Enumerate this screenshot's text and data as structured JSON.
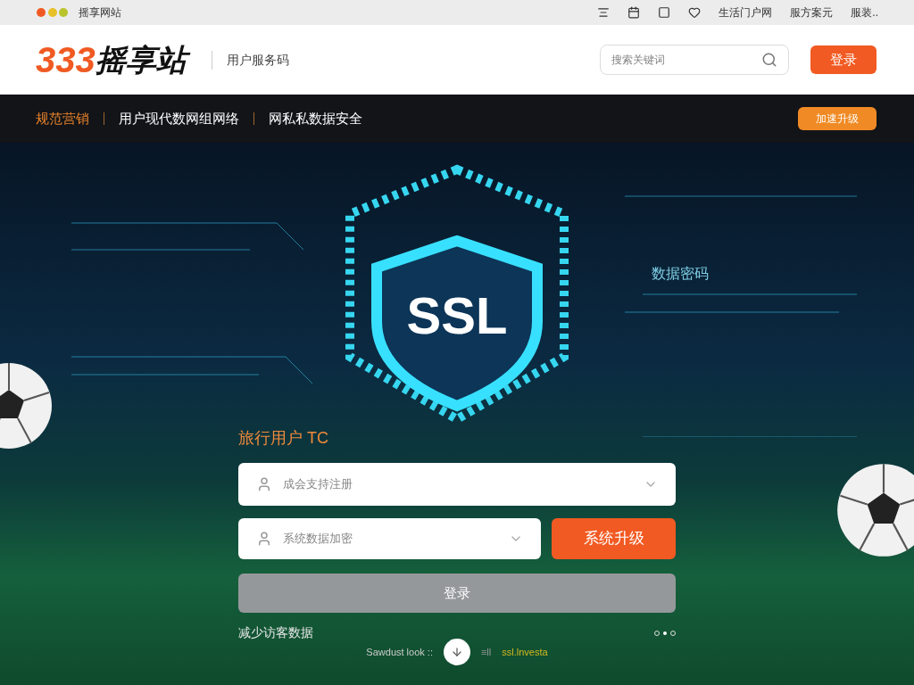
{
  "top_bar": {
    "site_name": "摇享网站",
    "links": [
      "生活门户网",
      "服方案元",
      "服装.."
    ]
  },
  "header": {
    "logo_number": "333",
    "logo_text": "摇享站",
    "tagline": "用户服务码",
    "search": {
      "placeholder": "搜索关键词"
    },
    "login_button": "登录"
  },
  "nav": {
    "items": [
      {
        "label": "规范营销",
        "selected": true
      },
      {
        "label": "用户现代数网组网络",
        "selected": false
      },
      {
        "label": "网私私数据安全",
        "selected": false
      }
    ],
    "action_button": "加速升级"
  },
  "hero": {
    "badge": "SSL",
    "caption": "数据密码"
  },
  "form": {
    "title": "旅行用户 TC",
    "account_field": {
      "placeholder": "成会支持注册"
    },
    "password_field": {
      "placeholder": "系统数据加密"
    },
    "upgrade_button": "系统升级",
    "login_button": {
      "label": "登录",
      "disabled": true
    },
    "note": "减少访客数据",
    "footer_text": "Sawdust look ::",
    "footer_mark": "≡ll",
    "footer_link": "ssl.lnvesta",
    "pager": [
      {
        "selected": false
      },
      {
        "selected": true
      },
      {
        "selected": false
      }
    ]
  }
}
